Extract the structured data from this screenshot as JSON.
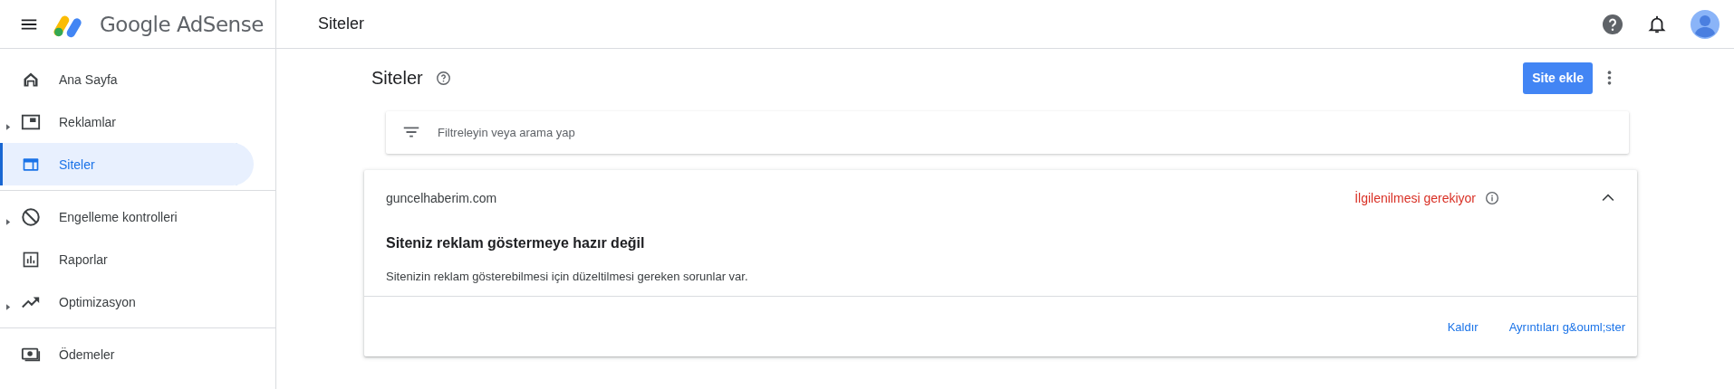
{
  "top_bar": {
    "product_name": "Google AdSense",
    "page_title": "Siteler"
  },
  "sidebar": {
    "sections": [
      [
        {
          "label": "Ana Sayfa",
          "kind": "link",
          "selected": false
        },
        {
          "label": "Reklamlar",
          "kind": "expandable",
          "selected": false
        },
        {
          "label": "Siteler",
          "kind": "link",
          "selected": true
        }
      ],
      [
        {
          "label": "Engelleme kontrolleri",
          "kind": "expandable",
          "selected": false
        },
        {
          "label": "Raporlar",
          "kind": "link",
          "selected": false
        },
        {
          "label": "Optimizasyon",
          "kind": "expandable",
          "selected": false
        }
      ],
      [
        {
          "label": "Ödemeler",
          "kind": "link",
          "selected": false
        }
      ]
    ]
  },
  "header": {
    "title": "Siteler",
    "add_button": "Site ekle"
  },
  "filter": {
    "placeholder": "Filtreleyin veya arama yap"
  },
  "sites": [
    {
      "domain": "guncelhaberim.com",
      "status": "İlgilenilmesi gerekiyor",
      "expanded": true,
      "title": "Siteniz reklam göstermeye hazır değil",
      "description": "Sitenizin reklam gösterebilmesi için düzeltilmesi gereken sorunlar var.",
      "actions": [
        "Kaldır",
        "Ayrıntıları g&ouml;ster"
      ]
    }
  ]
}
